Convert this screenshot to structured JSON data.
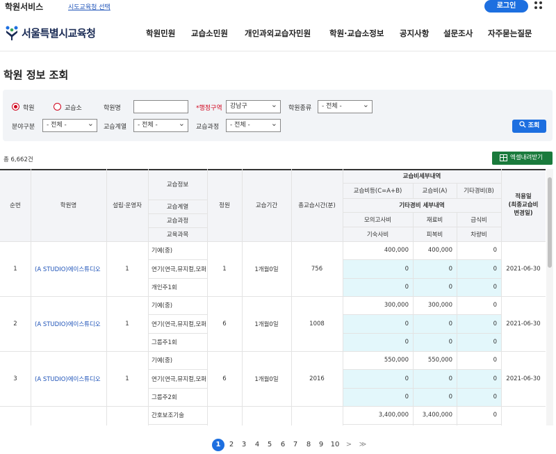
{
  "topbar": {
    "service": "학원서비스",
    "edu_select": "시도교육청 선택",
    "login": "로그인",
    "menu_icon": "grid-menu-icon"
  },
  "header": {
    "logo": "서울특별시교육청",
    "nav": [
      "학원민원",
      "교습소민원",
      "개인과외교습자민원",
      "학원·교습소정보",
      "공지사항",
      "설문조사",
      "자주묻는질문"
    ]
  },
  "page_title": "학원 정보 조회",
  "search": {
    "radio_academy": "학원",
    "radio_tutoring": "교습소",
    "name_label": "학원명",
    "name_value": "",
    "region_label": "*행정구역",
    "region_value": "강남구",
    "type_label": "학원종류",
    "type_value": "- 전체 -",
    "field_label": "분야구분",
    "field_value": "- 전체 -",
    "series_label": "교습계열",
    "series_value": "- 전체 -",
    "course_label": "교습과정",
    "course_value": "- 전체 -",
    "search_button": "조회"
  },
  "total": "총 6,662건",
  "excel_button": "엑셀내려받기",
  "table": {
    "headers": {
      "no": "순번",
      "name": "학원명",
      "owner": "설립·운영자",
      "lesson_info": "교습정보",
      "lesson_series": "교습계열",
      "lesson_course": "교습과정",
      "lesson_subject": "교육과목",
      "capacity": "정원",
      "period": "교습기간",
      "total_time": "총교습시간(분)",
      "fee_detail": "교습비세부내역",
      "fee_sum": "교습비등(C=A+B)",
      "fee_a": "교습비(A)",
      "fee_b": "기타경비(B)",
      "other_detail": "기타경비 세부내역",
      "mock": "모의고사비",
      "material": "재료비",
      "meal": "급식비",
      "dorm": "기숙사비",
      "clothes": "피복비",
      "vehicle": "차량비",
      "apply_date": "적용일\n(최종교습비\n변경일)"
    },
    "rows": [
      {
        "no": "1",
        "name": "(A STUDIO)에이스튜디오",
        "owner": "1",
        "series": "기예(중)",
        "course": "연기(연극,뮤지컬,모퍼",
        "subject": "개인주1회",
        "capacity": "1",
        "period": "1개월0일",
        "time": "756",
        "fee_sum": "400,000",
        "fee_a": "400,000",
        "fee_b": "0",
        "mock": "0",
        "material": "0",
        "meal": "0",
        "dorm": "0",
        "clothes": "0",
        "vehicle": "0",
        "date": "2021-06-30"
      },
      {
        "no": "2",
        "name": "(A STUDIO)에이스튜디오",
        "owner": "1",
        "series": "기예(중)",
        "course": "연기(연극,뮤지컬,모퍼",
        "subject": "그룹주1회",
        "capacity": "6",
        "period": "1개월0일",
        "time": "1008",
        "fee_sum": "300,000",
        "fee_a": "300,000",
        "fee_b": "0",
        "mock": "0",
        "material": "0",
        "meal": "0",
        "dorm": "0",
        "clothes": "0",
        "vehicle": "0",
        "date": "2021-06-30"
      },
      {
        "no": "3",
        "name": "(A STUDIO)에이스튜디오",
        "owner": "1",
        "series": "기예(중)",
        "course": "연기(연극,뮤지컬,모퍼",
        "subject": "그룹주2회",
        "capacity": "6",
        "period": "1개월0일",
        "time": "2016",
        "fee_sum": "550,000",
        "fee_a": "550,000",
        "fee_b": "0",
        "mock": "0",
        "material": "0",
        "meal": "0",
        "dorm": "0",
        "clothes": "0",
        "vehicle": "0",
        "date": "2021-06-30"
      }
    ],
    "partial_row": {
      "series": "간호보조기술",
      "fee_sum": "3,400,000",
      "fee_a": "3,400,000",
      "fee_b": "0"
    }
  },
  "pager": {
    "pages": [
      "1",
      "2",
      "3",
      "4",
      "5",
      "6",
      "7",
      "8",
      "9",
      "10"
    ],
    "current": "1",
    "next": ">",
    "last": "≫"
  }
}
